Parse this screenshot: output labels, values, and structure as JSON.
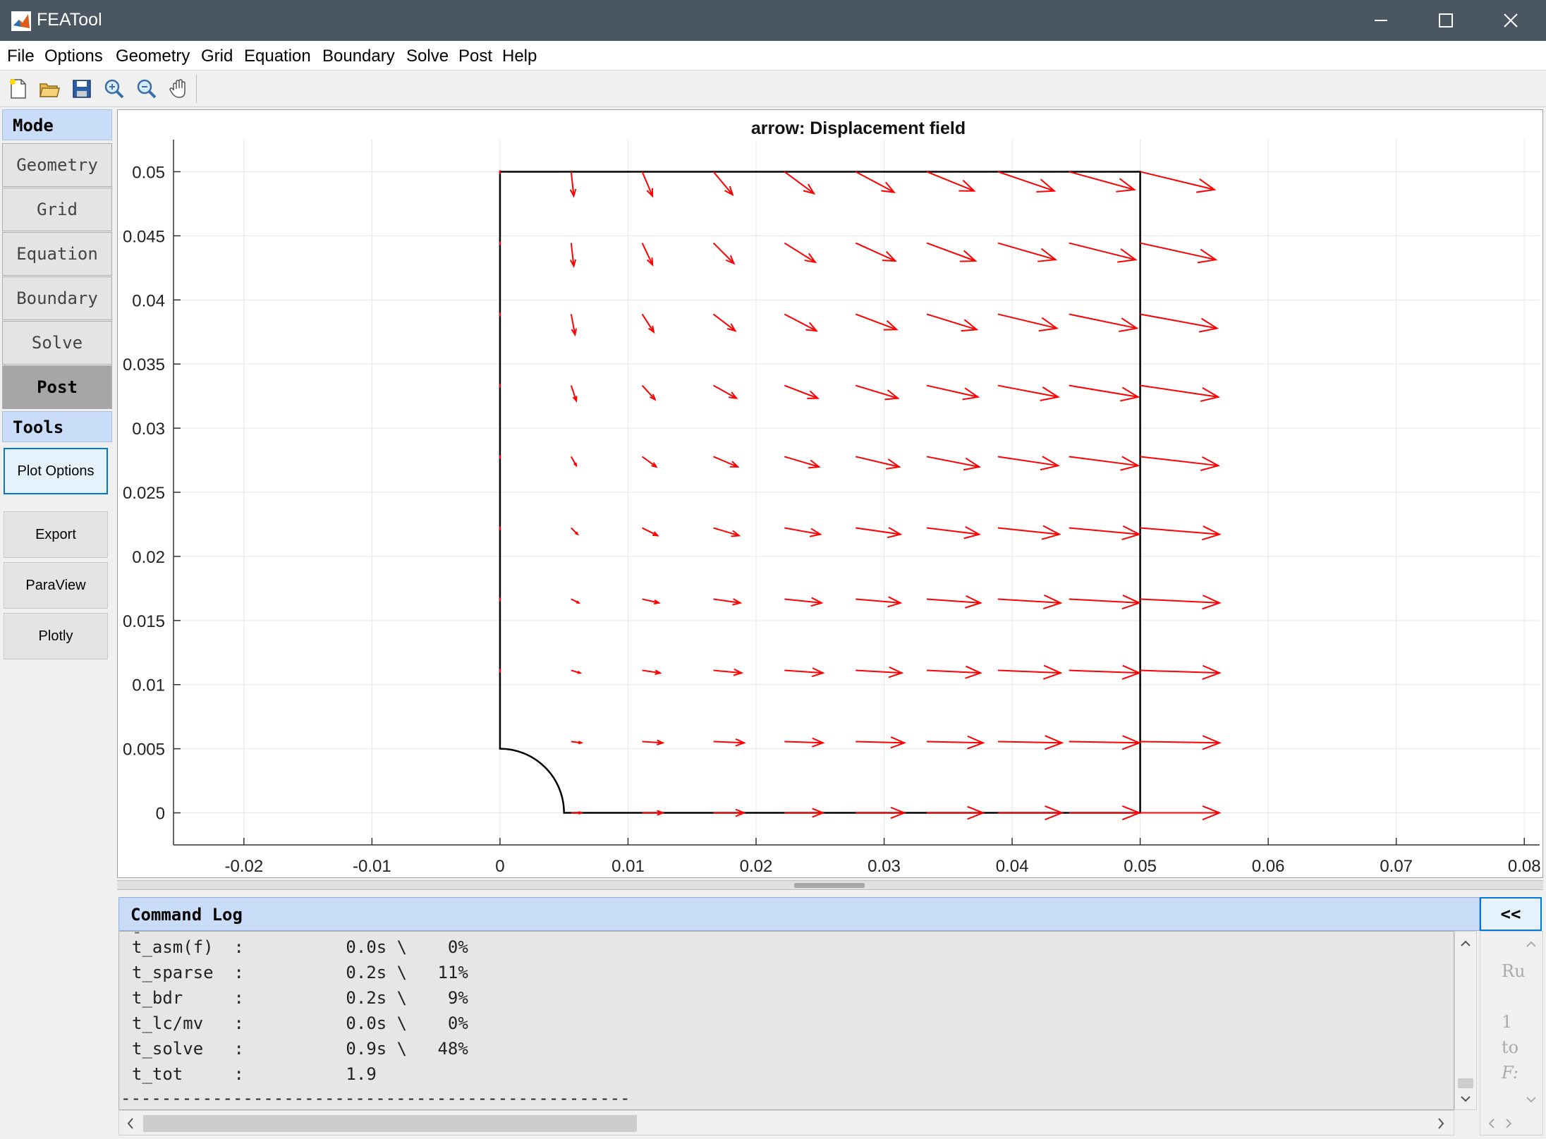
{
  "window": {
    "title": "FEATool"
  },
  "menu": [
    "File",
    "Options",
    "Geometry",
    "Grid",
    "Equation",
    "Boundary",
    "Solve",
    "Post",
    "Help"
  ],
  "toolbar": [
    "new-icon",
    "open-icon",
    "save-icon",
    "zoom-in-icon",
    "zoom-out-icon",
    "pan-icon"
  ],
  "sidebar": {
    "mode_label": "Mode",
    "modes": [
      "Geometry",
      "Grid",
      "Equation",
      "Boundary",
      "Solve",
      "Post"
    ],
    "active_mode": "Post",
    "tools_label": "Tools",
    "tools": [
      "Plot Options",
      "Export",
      "ParaView",
      "Plotly"
    ]
  },
  "plot": {
    "title": "arrow: Displacement field",
    "x_ticks": [
      "-0.02",
      "-0.01",
      "0",
      "0.01",
      "0.02",
      "0.03",
      "0.04",
      "0.05",
      "0.06",
      "0.07",
      "0.08"
    ],
    "y_ticks": [
      "0",
      "0.005",
      "0.01",
      "0.015",
      "0.02",
      "0.025",
      "0.03",
      "0.035",
      "0.04",
      "0.045",
      "0.05"
    ],
    "xlim": [
      -0.0255,
      0.0812
    ],
    "ylim": [
      -0.0025,
      0.0525
    ],
    "grid": true,
    "arrow_color": "#ff0000",
    "geometry_color": "#000000"
  },
  "chart_data": {
    "type": "quiver",
    "title": "arrow: Displacement field",
    "xlabel": "",
    "ylabel": "",
    "xlim": [
      -0.0255,
      0.0812
    ],
    "ylim": [
      -0.0025,
      0.0525
    ],
    "grid": true,
    "x": [
      0,
      0.00556,
      0.01111,
      0.01667,
      0.02222,
      0.02778,
      0.03333,
      0.03889,
      0.04444,
      0.05
    ],
    "y": [
      0,
      0.00556,
      0.01111,
      0.01667,
      0.02222,
      0.02778,
      0.03333,
      0.03889,
      0.04444,
      0.05
    ],
    "u_rows": [
      [
        null,
        0.0008,
        0.0016,
        0.0024,
        0.003,
        0.0038,
        0.0044,
        0.005,
        0.0055,
        0.0062
      ],
      [
        null,
        0.0008,
        0.0016,
        0.0024,
        0.003,
        0.0038,
        0.0044,
        0.005,
        0.0055,
        0.0062
      ],
      [
        0,
        0.0007,
        0.0014,
        0.0022,
        0.003,
        0.0036,
        0.0042,
        0.0049,
        0.0055,
        0.0062
      ],
      [
        0,
        0.0006,
        0.0013,
        0.0021,
        0.0029,
        0.0035,
        0.0042,
        0.0049,
        0.0055,
        0.0062
      ],
      [
        0,
        0.0005,
        0.0012,
        0.002,
        0.0028,
        0.0035,
        0.0041,
        0.0048,
        0.0055,
        0.0062
      ],
      [
        0,
        0.0004,
        0.0011,
        0.0019,
        0.0027,
        0.0034,
        0.0041,
        0.0047,
        0.0054,
        0.0061
      ],
      [
        0,
        0.0004,
        0.001,
        0.0018,
        0.0026,
        0.0033,
        0.004,
        0.0047,
        0.0054,
        0.0061
      ],
      [
        0,
        0.0003,
        0.0009,
        0.0017,
        0.0025,
        0.0032,
        0.0039,
        0.0046,
        0.0053,
        0.006
      ],
      [
        0,
        0.0002,
        0.0008,
        0.0016,
        0.0024,
        0.0031,
        0.0038,
        0.0045,
        0.0052,
        0.0059
      ],
      [
        0,
        0.0002,
        0.0008,
        0.0015,
        0.0023,
        0.003,
        0.0037,
        0.0044,
        0.0051,
        0.0058
      ]
    ],
    "v_rows": [
      [
        null,
        0,
        0,
        0,
        0,
        0,
        0,
        0,
        0,
        0
      ],
      [
        null,
        -0.0001,
        -0.0001,
        -0.0001,
        -0.0001,
        -0.0001,
        -0.0001,
        -0.0001,
        -0.0001,
        -0.0001
      ],
      [
        0,
        -0.0002,
        -0.0002,
        -0.0002,
        -0.0002,
        -0.0002,
        -0.0002,
        -0.0002,
        -0.0002,
        -0.0002
      ],
      [
        0,
        -0.0003,
        -0.0003,
        -0.0003,
        -0.0003,
        -0.0003,
        -0.0003,
        -0.0003,
        -0.0003,
        -0.0003
      ],
      [
        0,
        -0.0005,
        -0.0006,
        -0.0006,
        -0.0005,
        -0.0005,
        -0.0005,
        -0.0005,
        -0.0005,
        -0.0005
      ],
      [
        0,
        -0.0007,
        -0.0008,
        -0.0008,
        -0.0008,
        -0.0008,
        -0.0008,
        -0.0007,
        -0.0007,
        -0.0007
      ],
      [
        0,
        -0.0012,
        -0.0011,
        -0.001,
        -0.001,
        -0.001,
        -0.0009,
        -0.0009,
        -0.0009,
        -0.0009
      ],
      [
        0,
        -0.0016,
        -0.0014,
        -0.0013,
        -0.0013,
        -0.0012,
        -0.0012,
        -0.0011,
        -0.0011,
        -0.0011
      ],
      [
        0,
        -0.0018,
        -0.0017,
        -0.0016,
        -0.0015,
        -0.0014,
        -0.0014,
        -0.0013,
        -0.0013,
        -0.0013
      ],
      [
        0,
        -0.0019,
        -0.0019,
        -0.0018,
        -0.0017,
        -0.0016,
        -0.0015,
        -0.0015,
        -0.0014,
        -0.0014
      ]
    ],
    "geometry": {
      "x_range": [
        0,
        0.05
      ],
      "y_range": [
        0,
        0.05
      ],
      "hole_radius": 0.005
    }
  },
  "command_log": {
    "title": "Command Log",
    "collapse_label": "<<",
    "lines": [
      "t_asm(f)  :          0.0s \\    0%",
      "t_sparse  :          0.2s \\   11%",
      "t_bdr     :          0.2s \\    9%",
      "t_lc/mv   :          0.0s \\    0%",
      "t_solve   :          0.9s \\   48%",
      "t_tot     :          1.9",
      "--------------------------------------------------"
    ],
    "side_fragments": [
      "Ru",
      "1",
      "to",
      "F:"
    ]
  }
}
